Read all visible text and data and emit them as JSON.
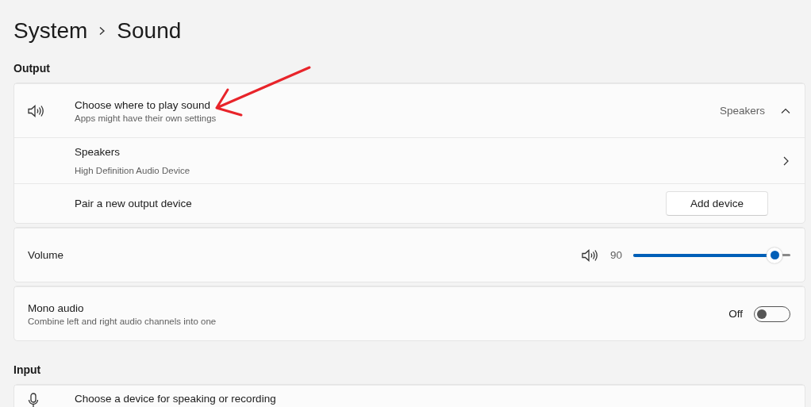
{
  "breadcrumb": [
    "System",
    "Sound"
  ],
  "sections": [
    {
      "title": "Output",
      "cards": [
        {
          "kind": "expander",
          "rows": [
            {
              "kind": "header",
              "title": "Choose where to play sound",
              "subtitle": "Apps might have their own settings",
              "value": "Speakers",
              "expanded": true
            },
            {
              "kind": "link",
              "title": "Speakers",
              "subtitle": "High Definition Audio Device"
            },
            {
              "kind": "button",
              "title": "Pair a new output device",
              "button": "Add device"
            }
          ]
        },
        {
          "kind": "plain",
          "rows": [
            {
              "kind": "slider",
              "title": "Volume",
              "reading": "90",
              "level": 0.9
            }
          ]
        },
        {
          "kind": "plain",
          "rows": [
            {
              "kind": "toggle",
              "title": "Mono audio",
              "subtitle": "Combine left and right audio channels into one",
              "state_label": "Off",
              "on": false
            }
          ]
        }
      ]
    },
    {
      "title": "Input",
      "cards": [
        {
          "kind": "expander",
          "rows": [
            {
              "kind": "header",
              "title": "Choose a device for speaking or recording"
            }
          ]
        }
      ]
    }
  ]
}
